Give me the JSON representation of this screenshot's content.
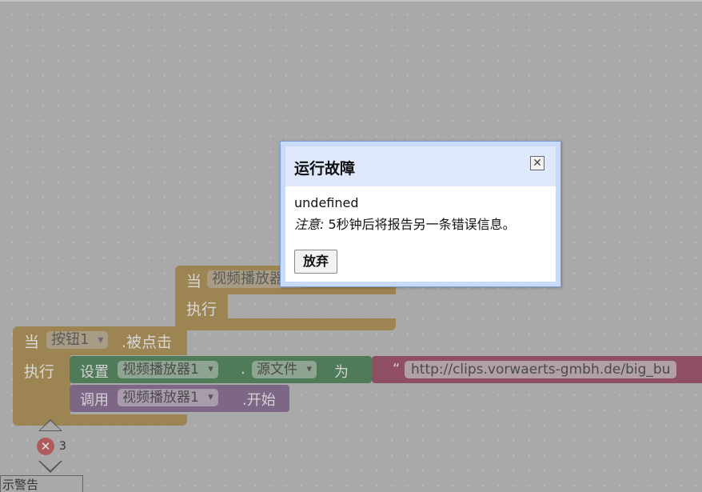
{
  "blocks": {
    "when_video": {
      "when": "当",
      "component": "视频播放器",
      "do": "执行"
    },
    "when_button": {
      "when": "当",
      "component": "按钮1",
      "event": ".被点击",
      "do": "执行"
    },
    "set_block": {
      "set": "设置",
      "component": "视频播放器1",
      "dot": ".",
      "property": "源文件",
      "to": "为",
      "quote": "“",
      "url": "http://clips.vorwaerts-gmbh.de/big_bu"
    },
    "call_block": {
      "call": "调用",
      "component": "视频播放器1",
      "method": ".开始"
    }
  },
  "warnings": {
    "error_count": "3",
    "tab_label": "示警告"
  },
  "dialog": {
    "title": "运行故障",
    "close_icon": "close-icon",
    "message": "undefined",
    "note_label": "注意:",
    "note_text": " 5秒钟后将报告另一条错误信息。",
    "dismiss_label": "放弃"
  },
  "colors": {
    "event_block": "#9c8552",
    "set_block": "#4f7b59",
    "call_block": "#7d6686",
    "string_block": "#8f4e63",
    "dialog_border": "#7b9fd4"
  }
}
